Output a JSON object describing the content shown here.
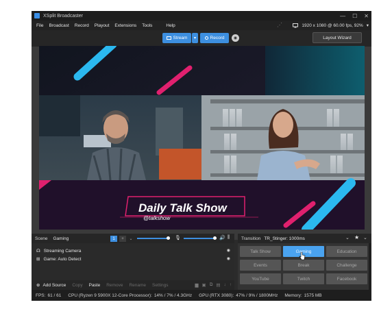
{
  "window": {
    "title": "XSplit Broadcaster",
    "controls": [
      "—",
      "☐",
      "✕"
    ]
  },
  "menu": {
    "items": [
      "File",
      "Broadcast",
      "Record",
      "Playout",
      "Extensions",
      "Tools"
    ],
    "help": "Help",
    "resolution": "1920 x 1080 @ 60.00 fps, 92%"
  },
  "toolbar": {
    "stream_label": "Stream",
    "record_label": "Record",
    "layout_wizard_label": "Layout Wizard"
  },
  "stage": {
    "show_title": "Daily Talk Show",
    "handle": "@talkshow"
  },
  "scene": {
    "label": "Scene",
    "name": "Gaming",
    "number": "1",
    "add": "+",
    "volume_left": 0.93,
    "volume_right": 0.93
  },
  "transition": {
    "label": "Transition",
    "name": "TR_Stinger: 1000ms"
  },
  "sources": [
    {
      "label": "Streaming Camera",
      "icon": "camera-icon"
    },
    {
      "label": "Game: Auto Detect",
      "icon": "gamepad-icon"
    }
  ],
  "source_tools": {
    "add": "Add Source",
    "copy": "Copy",
    "paste": "Paste",
    "remove": "Remove",
    "rename": "Rename",
    "settings": "Settings"
  },
  "presets": [
    "Talk Show",
    "Gaming",
    "Education",
    "Events",
    "Break",
    "Challenge",
    "YouTube",
    "Twitch",
    "Facebook"
  ],
  "active_preset": "Gaming",
  "status": {
    "fps_label": "FPS:",
    "fps_value": "61 / 61",
    "cpu_label": "CPU (Ryzen 9 5900X 12-Core Processor):",
    "cpu_value": "14% / 7% / 4.3GHz",
    "gpu_label": "GPU (RTX 3080):",
    "gpu_value": "47% / 9% / 1800MHz",
    "mem_label": "Memory:",
    "mem_value": "1575 MB"
  },
  "colors": {
    "accent": "#3d8fe0",
    "pink": "#e0206e",
    "cyan": "#2bb8ef"
  }
}
